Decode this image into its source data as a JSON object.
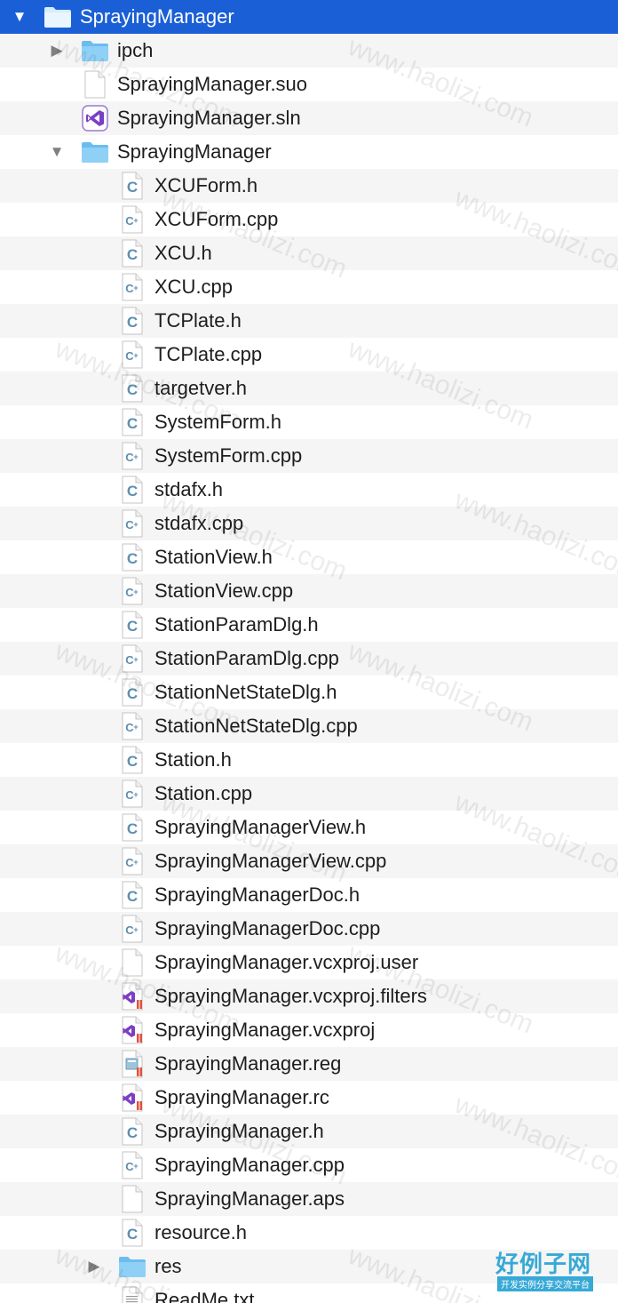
{
  "tree": [
    {
      "label": "SprayingManager",
      "depth": 0,
      "icon": "folder",
      "disclosure": "expanded",
      "selected": true
    },
    {
      "label": "ipch",
      "depth": 1,
      "icon": "folder",
      "disclosure": "collapsed"
    },
    {
      "label": "SprayingManager.suo",
      "depth": 1,
      "icon": "file"
    },
    {
      "label": "SprayingManager.sln",
      "depth": 1,
      "icon": "vs"
    },
    {
      "label": "SprayingManager",
      "depth": 1,
      "icon": "folder",
      "disclosure": "expanded"
    },
    {
      "label": "XCUForm.h",
      "depth": 2,
      "icon": "c-header"
    },
    {
      "label": "XCUForm.cpp",
      "depth": 2,
      "icon": "cpp"
    },
    {
      "label": "XCU.h",
      "depth": 2,
      "icon": "c-header"
    },
    {
      "label": "XCU.cpp",
      "depth": 2,
      "icon": "cpp"
    },
    {
      "label": "TCPlate.h",
      "depth": 2,
      "icon": "c-header"
    },
    {
      "label": "TCPlate.cpp",
      "depth": 2,
      "icon": "cpp"
    },
    {
      "label": "targetver.h",
      "depth": 2,
      "icon": "c-header"
    },
    {
      "label": "SystemForm.h",
      "depth": 2,
      "icon": "c-header"
    },
    {
      "label": "SystemForm.cpp",
      "depth": 2,
      "icon": "cpp"
    },
    {
      "label": "stdafx.h",
      "depth": 2,
      "icon": "c-header"
    },
    {
      "label": "stdafx.cpp",
      "depth": 2,
      "icon": "cpp"
    },
    {
      "label": "StationView.h",
      "depth": 2,
      "icon": "c-header"
    },
    {
      "label": "StationView.cpp",
      "depth": 2,
      "icon": "cpp"
    },
    {
      "label": "StationParamDlg.h",
      "depth": 2,
      "icon": "c-header"
    },
    {
      "label": "StationParamDlg.cpp",
      "depth": 2,
      "icon": "cpp"
    },
    {
      "label": "StationNetStateDlg.h",
      "depth": 2,
      "icon": "c-header"
    },
    {
      "label": "StationNetStateDlg.cpp",
      "depth": 2,
      "icon": "cpp"
    },
    {
      "label": "Station.h",
      "depth": 2,
      "icon": "c-header"
    },
    {
      "label": "Station.cpp",
      "depth": 2,
      "icon": "cpp"
    },
    {
      "label": "SprayingManagerView.h",
      "depth": 2,
      "icon": "c-header"
    },
    {
      "label": "SprayingManagerView.cpp",
      "depth": 2,
      "icon": "cpp"
    },
    {
      "label": "SprayingManagerDoc.h",
      "depth": 2,
      "icon": "c-header"
    },
    {
      "label": "SprayingManagerDoc.cpp",
      "depth": 2,
      "icon": "cpp"
    },
    {
      "label": "SprayingManager.vcxproj.user",
      "depth": 2,
      "icon": "file"
    },
    {
      "label": "SprayingManager.vcxproj.filters",
      "depth": 2,
      "icon": "vs-doc"
    },
    {
      "label": "SprayingManager.vcxproj",
      "depth": 2,
      "icon": "vs-doc"
    },
    {
      "label": "SprayingManager.reg",
      "depth": 2,
      "icon": "reg"
    },
    {
      "label": "SprayingManager.rc",
      "depth": 2,
      "icon": "vs-doc"
    },
    {
      "label": "SprayingManager.h",
      "depth": 2,
      "icon": "c-header"
    },
    {
      "label": "SprayingManager.cpp",
      "depth": 2,
      "icon": "cpp"
    },
    {
      "label": "SprayingManager.aps",
      "depth": 2,
      "icon": "file"
    },
    {
      "label": "resource.h",
      "depth": 2,
      "icon": "c-header"
    },
    {
      "label": "res",
      "depth": 2,
      "icon": "folder",
      "disclosure": "collapsed"
    },
    {
      "label": "ReadMe.txt",
      "depth": 2,
      "icon": "text"
    }
  ],
  "watermark": {
    "text": "www.haolizi.com"
  },
  "logo": {
    "title": "好例子网",
    "subtitle": "开发实例分享交流平台"
  },
  "colors": {
    "selection": "#1a5fd6",
    "folder": "#6cbcf0",
    "c_header": "#5d8fb0",
    "vs_purple": "#7b3fc4",
    "logo": "#37a9d6"
  }
}
